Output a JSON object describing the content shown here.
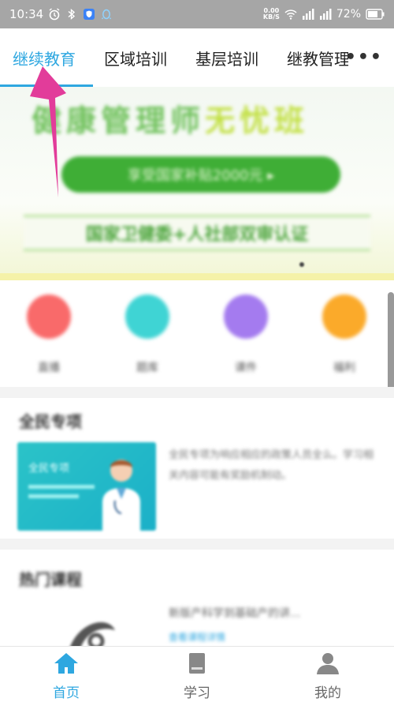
{
  "status_bar": {
    "time": "10:34",
    "net_speed_value": "0.00",
    "net_speed_unit": "KB/S",
    "battery": "72%"
  },
  "tabs": [
    {
      "label": "继续教育",
      "active": true
    },
    {
      "label": "区域培训",
      "active": false
    },
    {
      "label": "基层培训",
      "active": false
    },
    {
      "label": "继教管理",
      "active": false
    }
  ],
  "tab_more": "•••",
  "banner": {
    "title_main": "健康管理师",
    "title_highlight": "无忧班",
    "pill_text": "享受国家补贴2000元 ▸",
    "subtitle": "国家卫健委+人社部双审认证"
  },
  "quick_actions": [
    {
      "label": "直播",
      "color": "#f96a6a"
    },
    {
      "label": "题库",
      "color": "#3fd4d4"
    },
    {
      "label": "课件",
      "color": "#a47bef"
    },
    {
      "label": "福利",
      "color": "#fbaa2a"
    }
  ],
  "section_special": {
    "title": "全民专项",
    "card_image_text": "全民专项",
    "description": "全民专项为响应相应的政策人员全么。学习相关内容可能有奖励机制动。"
  },
  "section_hot": {
    "title": "热门课程",
    "item_title": "新版产科学到基础产的讲...",
    "item_link": "查看课程详情"
  },
  "bottom_nav": [
    {
      "label": "首页",
      "active": true
    },
    {
      "label": "学习",
      "active": false
    },
    {
      "label": "我的",
      "active": false
    }
  ],
  "colors": {
    "accent": "#2ea7e0",
    "arrow": "#e23c9a",
    "status_bar": "#a6a6a6"
  }
}
